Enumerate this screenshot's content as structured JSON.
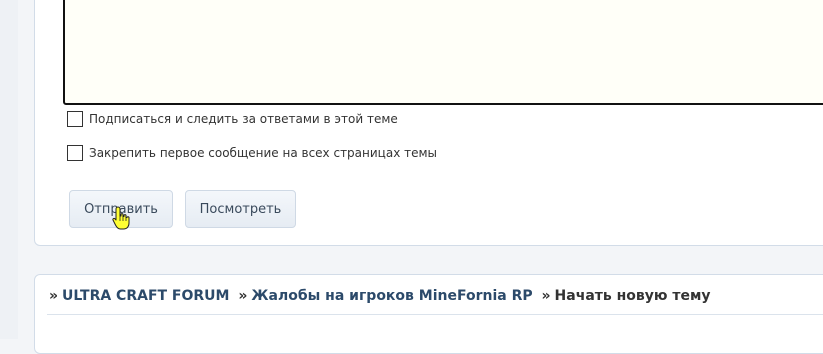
{
  "form": {
    "options": [
      {
        "label": "Подписаться и следить за ответами в этой теме",
        "checked": false
      },
      {
        "label": "Закрепить первое сообщение на всех страницах темы",
        "checked": false
      }
    ],
    "submit_label": "Отправить",
    "preview_label": "Посмотреть"
  },
  "breadcrumb": {
    "prefix": "»",
    "items": [
      {
        "label": "ULTRA CRAFT FORUM"
      },
      {
        "label": "Жалобы на игроков MineFornia RP"
      }
    ],
    "current": "Начать новую тему"
  }
}
